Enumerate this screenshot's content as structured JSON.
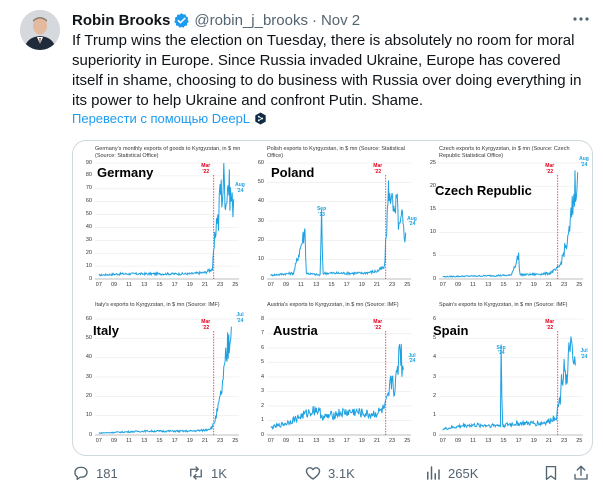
{
  "tweet": {
    "author_name": "Robin Brooks",
    "handle": "@robin_j_brooks",
    "separator": "·",
    "date": "Nov 2",
    "text": "If Trump wins the election on Tuesday, there is absolutely no room for moral superiority in Europe. Since Russia invaded Ukraine, Europe has covered itself in shame, choosing to do business with Russia over doing everything in its power to help Ukraine and confront Putin. Shame.",
    "translate_link": "Перевести с помощью DeepL"
  },
  "actions": {
    "replies": "181",
    "reposts": "1K",
    "likes": "3.1K",
    "views": "265K"
  },
  "colors": {
    "line": "#1da1e0",
    "marker": "#e8001d",
    "link": "#1d9bf0",
    "muted": "#536471"
  },
  "xticks": [
    "07",
    "09",
    "11",
    "13",
    "15",
    "17",
    "19",
    "21",
    "23",
    "25"
  ],
  "chart_data": [
    {
      "type": "line",
      "title": "Germany's monthly exports of goods to Kyrgyzstan, in $ mn (Source: Statistical Office)",
      "label": "Germany",
      "ylim": [
        0,
        90
      ],
      "yticks": [
        "0",
        "10",
        "20",
        "30",
        "40",
        "50",
        "60",
        "70",
        "80",
        "90"
      ],
      "event_marker": {
        "x": 2022.17,
        "label": "Mar '22"
      },
      "annotation": {
        "text": "Aug '24"
      },
      "series_points": [
        [
          2007,
          3
        ],
        [
          2010,
          4
        ],
        [
          2013,
          4
        ],
        [
          2016,
          4
        ],
        [
          2019,
          4
        ],
        [
          2021,
          5
        ],
        [
          2022,
          8
        ],
        [
          2022.3,
          30
        ],
        [
          2022.6,
          50
        ],
        [
          2022.8,
          42
        ],
        [
          2023,
          72
        ],
        [
          2023.3,
          65
        ],
        [
          2023.5,
          80
        ],
        [
          2023.8,
          60
        ],
        [
          2024,
          76
        ],
        [
          2024.3,
          68
        ],
        [
          2024.6,
          58
        ],
        [
          2024.8,
          62
        ]
      ]
    },
    {
      "type": "line",
      "title": "Polish exports to Kyrgyzstan, in $ mn (Source: Statistical Office)",
      "label": "Poland",
      "ylim": [
        0,
        60
      ],
      "yticks": [
        "0",
        "10",
        "20",
        "30",
        "40",
        "50",
        "60"
      ],
      "event_marker": {
        "x": 2022.17,
        "label": "Mar '22"
      },
      "annotation": {
        "text": "Sep '13",
        "x": 2013.7
      },
      "annotation2": {
        "text": "Aug '24"
      },
      "series_points": [
        [
          2007,
          2
        ],
        [
          2010,
          3
        ],
        [
          2011.5,
          25
        ],
        [
          2011.7,
          3
        ],
        [
          2013.5,
          2
        ],
        [
          2013.7,
          30
        ],
        [
          2013.9,
          3
        ],
        [
          2016,
          3
        ],
        [
          2019,
          3
        ],
        [
          2021,
          4
        ],
        [
          2022,
          6
        ],
        [
          2022.3,
          28
        ],
        [
          2022.6,
          50
        ],
        [
          2022.8,
          35
        ],
        [
          2023,
          52
        ],
        [
          2023.3,
          30
        ],
        [
          2023.6,
          40
        ],
        [
          2024,
          25
        ],
        [
          2024.3,
          32
        ],
        [
          2024.6,
          22
        ],
        [
          2024.8,
          24
        ]
      ]
    },
    {
      "type": "line",
      "title": "Czech exports to Kyrgyzstan, in $ mn (Source: Czech Republic Statistical Office)",
      "label": "Czech Republic",
      "ylim": [
        0,
        25
      ],
      "yticks": [
        "0",
        "5",
        "10",
        "15",
        "20",
        "25"
      ],
      "event_marker": {
        "x": 2022.17,
        "label": "Mar '22"
      },
      "annotation": {
        "text": "Aug '24"
      },
      "series_points": [
        [
          2007,
          0.5
        ],
        [
          2010,
          0.6
        ],
        [
          2013,
          0.7
        ],
        [
          2016,
          0.8
        ],
        [
          2017,
          5
        ],
        [
          2017.2,
          0.9
        ],
        [
          2019,
          1
        ],
        [
          2021,
          1.2
        ],
        [
          2022,
          2
        ],
        [
          2022.5,
          3
        ],
        [
          2023,
          6
        ],
        [
          2023.5,
          8
        ],
        [
          2024,
          14
        ],
        [
          2024.3,
          18
        ],
        [
          2024.6,
          22
        ],
        [
          2024.8,
          23
        ]
      ]
    },
    {
      "type": "line",
      "title": "Italy's exports to Kyrgyzstan, in $ mn (Source: IMF)",
      "label": "Italy",
      "ylim": [
        0,
        60
      ],
      "yticks": [
        "0",
        "10",
        "20",
        "30",
        "40",
        "50",
        "60"
      ],
      "event_marker": {
        "x": 2022.17,
        "label": "Mar '22"
      },
      "annotation": {
        "text": "Jul '24"
      },
      "series_points": [
        [
          2007,
          1
        ],
        [
          2010,
          1.5
        ],
        [
          2013,
          2
        ],
        [
          2016,
          2
        ],
        [
          2019,
          2
        ],
        [
          2021,
          2.5
        ],
        [
          2022,
          4
        ],
        [
          2022.5,
          10
        ],
        [
          2023,
          18
        ],
        [
          2023.5,
          30
        ],
        [
          2024,
          45
        ],
        [
          2024.3,
          52
        ],
        [
          2024.5,
          56
        ]
      ]
    },
    {
      "type": "line",
      "title": "Austria's exports to Kyrgyzstan, in $ mn (Source: IMF)",
      "label": "Austria",
      "ylim": [
        0,
        8
      ],
      "yticks": [
        "0",
        "1",
        "2",
        "3",
        "4",
        "5",
        "6",
        "7",
        "8"
      ],
      "event_marker": {
        "x": 2022.17,
        "label": "Mar '22"
      },
      "annotation": {
        "text": "Jul '24"
      },
      "series_points": [
        [
          2007,
          0.5
        ],
        [
          2009,
          0.8
        ],
        [
          2011,
          1.3
        ],
        [
          2013,
          1.8
        ],
        [
          2014,
          1.2
        ],
        [
          2016,
          1.5
        ],
        [
          2018,
          1.6
        ],
        [
          2020,
          1.4
        ],
        [
          2021,
          1.5
        ],
        [
          2022,
          1.8
        ],
        [
          2022.5,
          2.5
        ],
        [
          2023,
          4
        ],
        [
          2023.4,
          3
        ],
        [
          2023.8,
          5
        ],
        [
          2024,
          6.5
        ],
        [
          2024.3,
          5
        ],
        [
          2024.5,
          4.5
        ]
      ]
    },
    {
      "type": "line",
      "title": "Spain's exports to Kyrgyzstan, in $ mn (Source: IMF)",
      "label": "Spain",
      "ylim": [
        0,
        6
      ],
      "yticks": [
        "0",
        "1",
        "2",
        "3",
        "4",
        "5",
        "6"
      ],
      "event_marker": {
        "x": 2022.17,
        "label": "Mar '22"
      },
      "annotation": {
        "text": "Sep '14",
        "x": 2014.7
      },
      "annotation2": {
        "text": "Jul '24"
      },
      "series_points": [
        [
          2007,
          0.3
        ],
        [
          2010,
          0.5
        ],
        [
          2013,
          0.5
        ],
        [
          2014.6,
          0.5
        ],
        [
          2014.7,
          3.9
        ],
        [
          2014.9,
          0.5
        ],
        [
          2017,
          0.6
        ],
        [
          2020,
          0.6
        ],
        [
          2021,
          0.7
        ],
        [
          2022,
          1
        ],
        [
          2022.5,
          2
        ],
        [
          2023,
          4
        ],
        [
          2023.4,
          2.5
        ],
        [
          2023.8,
          5
        ],
        [
          2024,
          4
        ],
        [
          2024.3,
          3.5
        ],
        [
          2024.5,
          3.6
        ]
      ]
    }
  ]
}
